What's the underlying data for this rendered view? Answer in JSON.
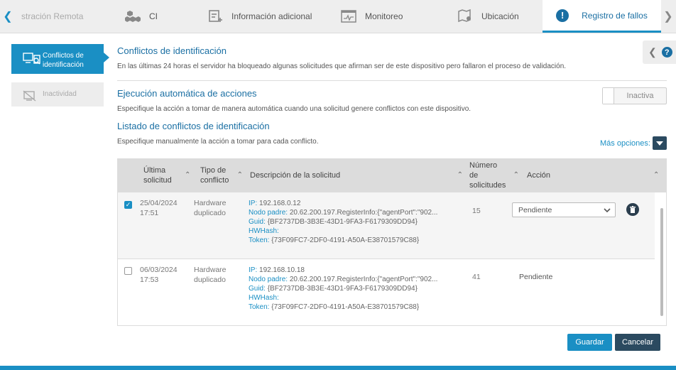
{
  "tabs": [
    {
      "label": "stración Remota",
      "icon": "arrow-left-icon"
    },
    {
      "label": "CI",
      "icon": "boxes-icon"
    },
    {
      "label": "Información adicional",
      "icon": "notes-add-icon"
    },
    {
      "label": "Monitoreo",
      "icon": "monitor-chart-icon"
    },
    {
      "label": "Ubicación",
      "icon": "map-pin-icon"
    },
    {
      "label": "Registro de fallos",
      "icon": "alert-circle-icon"
    }
  ],
  "sidebar": {
    "items": [
      {
        "label": "Conflictos de identificación",
        "active": true
      },
      {
        "label": "Inactividad",
        "active": false
      }
    ]
  },
  "conflicts": {
    "title": "Conflictos de identificación",
    "description": "En las últimas 24 horas el servidor ha bloqueado algunas solicitudes que afirman ser de este dispositivo pero fallaron el proceso de validación."
  },
  "auto_actions": {
    "title": "Ejecución automática de acciones",
    "description": "Especifique la acción a tomar de manera automática cuando una solicitud genere conflictos con este dispositivo.",
    "toggle_label": "Inactiva"
  },
  "list": {
    "title": "Listado de conflictos de identificación",
    "description": "Especifique manualmente la acción a tomar para cada conflicto.",
    "more_options": "Más opciones:"
  },
  "table": {
    "headers": {
      "date": "Última solicitud",
      "type": "Tipo de conflicto",
      "description": "Descripción de la solicitud",
      "count": "Número de solicitudes",
      "action": "Acción"
    },
    "rows": [
      {
        "checked": true,
        "date": "25/04/2024",
        "time": "17:51",
        "type": "Hardware duplicado",
        "ip_label": "IP:",
        "ip": "192.168.0.12",
        "parent_label": "Nodo padre:",
        "parent": "20.62.200.197.RegisterInfo:{\"agentPort\":\"902...",
        "guid_label": "Guid:",
        "guid": "{BF2737DB-3B3E-43D1-9FA3-F6179309DD94}",
        "hwhash_label": "HWHash:",
        "hwhash": "",
        "token_label": "Token:",
        "token": "{73F09FC7-2DF0-4191-A50A-E38701579C88}",
        "count": "15",
        "action": "Pendiente"
      },
      {
        "checked": false,
        "date": "06/03/2024",
        "time": "17:53",
        "type": "Hardware duplicado",
        "ip_label": "IP:",
        "ip": "192.168.10.18",
        "parent_label": "Nodo padre:",
        "parent": "20.62.200.197.RegisterInfo:{\"agentPort\":\"902...",
        "guid_label": "Guid:",
        "guid": "{BF2737DB-3B3E-43D1-9FA3-F6179309DD94}",
        "hwhash_label": "HWHash:",
        "hwhash": "",
        "token_label": "Token:",
        "token": "{73F09FC7-2DF0-4191-A50A-E38701579C88}",
        "count": "41",
        "action": "Pendiente"
      }
    ]
  },
  "buttons": {
    "save": "Guardar",
    "cancel": "Cancelar"
  },
  "colors": {
    "accent": "#1a8fc4",
    "dark": "#2b4a60"
  }
}
